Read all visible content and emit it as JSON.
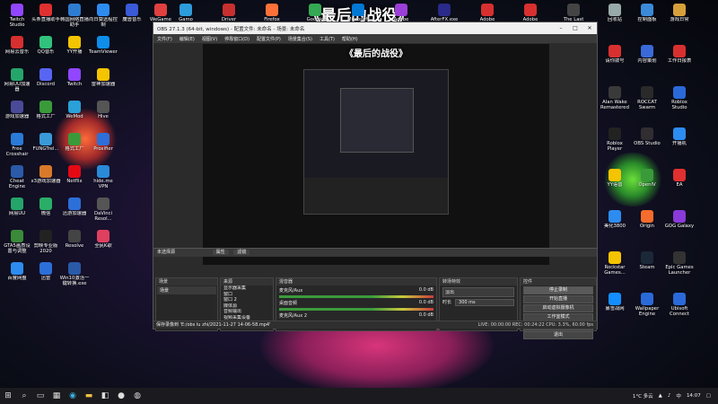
{
  "overlay_title": "《最后的战役》",
  "desktop_left": [
    {
      "label": "Twitch Studio",
      "color": "#9146ff"
    },
    {
      "label": "头条直播助手",
      "color": "#e03030"
    },
    {
      "label": "韩国网络直播助手",
      "color": "#2e7dd1"
    },
    {
      "label": "向日葵远程控制",
      "color": "#2d8cf0"
    },
    {
      "label": "魔兽音乐",
      "color": "#3a5ad8"
    },
    {
      "label": "WeGame",
      "color": "#e04040"
    },
    {
      "label": "网易云音乐",
      "color": "#d62f2f"
    },
    {
      "label": "QQ音乐",
      "color": "#31c27c"
    },
    {
      "label": "YY开播",
      "color": "#f5c400"
    },
    {
      "label": "TeamViewer",
      "color": "#0e8ee9"
    },
    {
      "label": "网易UU加速器",
      "color": "#25a56a"
    },
    {
      "label": "Discord",
      "color": "#5865f2"
    },
    {
      "label": "Twitch",
      "color": "#9146ff"
    },
    {
      "label": "雷神加速器",
      "color": "#f5c400"
    },
    {
      "label": "游戏加速器",
      "color": "#4a4a9a"
    },
    {
      "label": "格式工厂",
      "color": "#3a9a3a"
    },
    {
      "label": "WeMod",
      "color": "#2aa0d8"
    },
    {
      "label": "Hive",
      "color": "#555"
    },
    {
      "label": "Free Crosshair",
      "color": "#2a7ad8"
    },
    {
      "label": "FUNGTrel...",
      "color": "#3a9ad8"
    },
    {
      "label": "格式工厂",
      "color": "#3a9a3a"
    },
    {
      "label": "Proxifier",
      "color": "#2d6fd8"
    },
    {
      "label": "Cheat Engine",
      "color": "#2a5aa8"
    },
    {
      "label": "x3游戏加速器",
      "color": "#d87a2a"
    },
    {
      "label": "Netflix",
      "color": "#e50914"
    },
    {
      "label": "hide.me VPN",
      "color": "#2a8ad8"
    },
    {
      "label": "网易UU",
      "color": "#25a56a"
    },
    {
      "label": "微信",
      "color": "#2aae67"
    },
    {
      "label": "迅游加速器",
      "color": "#2d6fd8"
    },
    {
      "label": "DaVinci Resol...",
      "color": "#555"
    },
    {
      "label": "GTA5画质设置与调整",
      "color": "#3a8a3a"
    },
    {
      "label": "剪映专业版 2020",
      "color": "#222"
    },
    {
      "label": "Resolve",
      "color": "#444"
    },
    {
      "label": "全民K歌",
      "color": "#e04060"
    },
    {
      "label": "百度网盘",
      "color": "#2d8cf0"
    },
    {
      "label": "迅雷",
      "color": "#2d6fd8"
    },
    {
      "label": "Win10激活一键转换.exe",
      "color": "#2a5aa8"
    }
  ],
  "desktop_top_row": [
    {
      "label": "Gamo",
      "color": "#2d9cdb"
    },
    {
      "label": "Driver",
      "color": "#c83030"
    },
    {
      "label": "Firefox",
      "color": "#ff7139"
    },
    {
      "label": "Google",
      "color": "#34a853"
    },
    {
      "label": "Microsoft",
      "color": "#0078d4"
    },
    {
      "label": "Adobe",
      "color": "#9b3fd8"
    },
    {
      "label": "AfterFX.exe",
      "color": "#2a2a8a"
    },
    {
      "label": "Adobe",
      "color": "#d83030"
    },
    {
      "label": "Adobe",
      "color": "#d83030"
    },
    {
      "label": "The Last",
      "color": "#444"
    }
  ],
  "desktop_right": [
    {
      "label": "回收站",
      "color": "#9aa"
    },
    {
      "label": "控制面板",
      "color": "#3a8ad8"
    },
    {
      "label": "游戏日常",
      "color": "#d8a03a"
    },
    {
      "label": "请你拨号",
      "color": "#d83030"
    },
    {
      "label": "内容策划",
      "color": "#3a6ad8"
    },
    {
      "label": "工作日报表",
      "color": "#d83030"
    },
    {
      "label": "Alan Wake Remastered",
      "color": "#3a3a3a"
    },
    {
      "label": "ROCCAT Swarm",
      "color": "#2a2a2a"
    },
    {
      "label": "Roblox Studio",
      "color": "#2a6ad8"
    },
    {
      "label": "Roblox Player",
      "color": "#222"
    },
    {
      "label": "OBS Studio",
      "color": "#302e31"
    },
    {
      "label": "开播机",
      "color": "#2d8cf0"
    },
    {
      "label": "YY语音",
      "color": "#f5c400"
    },
    {
      "label": "OpenIV",
      "color": "#3a9a3a"
    },
    {
      "label": "EA",
      "color": "#e03030"
    },
    {
      "label": "美化3800",
      "color": "#2d8cf0"
    },
    {
      "label": "Origin",
      "color": "#f56c2d"
    },
    {
      "label": "GOG Galaxy",
      "color": "#8a3ad8"
    },
    {
      "label": "Rockstar Games...",
      "color": "#f5c400"
    },
    {
      "label": "Steam",
      "color": "#1b2838"
    },
    {
      "label": "Epic Games Launcher",
      "color": "#333"
    },
    {
      "label": "暴雪战网",
      "color": "#148eff"
    },
    {
      "label": "Wallpaper Engine",
      "color": "#2a6ad8"
    },
    {
      "label": "Ubisoft Connect",
      "color": "#2a6ad8"
    }
  ],
  "obs": {
    "title": "OBS 27.1.3 (64-bit, windows) - 配置文件: 未命名 - 场景: 未命名",
    "menu": [
      "文件(F)",
      "编辑(E)",
      "视图(V)",
      "停靠窗口(D)",
      "配置文件(P)",
      "场景集合(S)",
      "工具(T)",
      "帮助(H)"
    ],
    "top_row_label": "未选择源",
    "top_row_buttons": [
      "属性",
      "滤镜"
    ],
    "docks": {
      "scenes": {
        "header": "场景",
        "items": [
          "场景"
        ]
      },
      "sources": {
        "header": "来源",
        "items": [
          "显示器采集",
          "窗口",
          "窗口 2",
          "媒体源",
          "音频输出",
          "视频采集设备",
          "文本"
        ]
      },
      "mixer": {
        "header": "混音器",
        "tracks": [
          {
            "name": "麦克风/Aux",
            "db": "0.0 dB"
          },
          {
            "name": "桌面音频",
            "db": "0.0 dB"
          },
          {
            "name": "麦克风/Aux 2",
            "db": "0.0 dB"
          }
        ]
      },
      "transitions": {
        "header": "转场特效",
        "type": "淡出",
        "duration_label": "时长",
        "duration": "300 ms"
      },
      "controls": {
        "header": "控件",
        "buttons": [
          "停止录制",
          "开始直播",
          "启动虚拟摄像机",
          "工作室模式",
          "设置",
          "退出"
        ]
      }
    },
    "status": {
      "left": "保存录像到 'E:/obs lu zhi/2021-11-27 14-06-58.mp4'",
      "right": "LIVE: 00:00:00   REC: 00:24:22   CPU: 3.3%, 60.00 fps"
    }
  },
  "taskbar": {
    "search_icon": "search-icon",
    "weather": "1°C 多云",
    "ime": "中",
    "time": "14:07"
  }
}
